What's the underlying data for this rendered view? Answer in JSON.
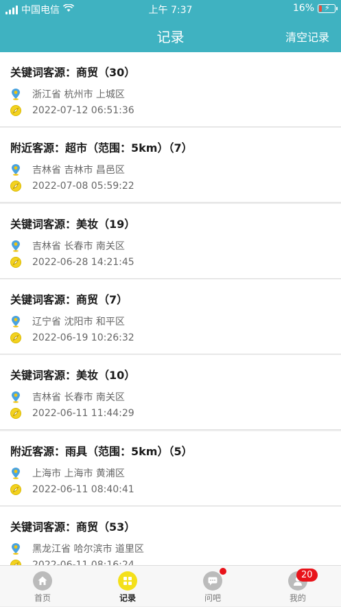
{
  "status_bar": {
    "carrier": "中国电信",
    "time": "上午 7:37",
    "battery": "16%"
  },
  "nav": {
    "title": "记录",
    "clear_label": "清空记录"
  },
  "records": [
    {
      "title": "关键词客源：商贸（30）",
      "location": "浙江省 杭州市 上城区",
      "time": "2022-07-12 06:51:36"
    },
    {
      "title": "附近客源：超市（范围：5km）（7）",
      "location": "吉林省 吉林市 昌邑区",
      "time": "2022-07-08 05:59:22"
    },
    {
      "title": "关键词客源：美妆（19）",
      "location": "吉林省 长春市 南关区",
      "time": "2022-06-28 14:21:45"
    },
    {
      "title": "关键词客源：商贸（7）",
      "location": "辽宁省 沈阳市 和平区",
      "time": "2022-06-19 10:26:32"
    },
    {
      "title": "关键词客源：美妆（10）",
      "location": "吉林省 长春市 南关区",
      "time": "2022-06-11 11:44:29"
    },
    {
      "title": "附近客源：雨具（范围：5km）（5）",
      "location": "上海市 上海市 黄浦区",
      "time": "2022-06-11 08:40:41"
    },
    {
      "title": "关键词客源：商贸（53）",
      "location": "黑龙江省 哈尔滨市 道里区",
      "time": "2022-06-11 08:16:24"
    }
  ],
  "tabs": [
    {
      "label": "首页",
      "icon": "home-icon"
    },
    {
      "label": "记录",
      "icon": "grid-icon"
    },
    {
      "label": "问吧",
      "icon": "chat-icon"
    },
    {
      "label": "我的",
      "icon": "user-icon",
      "badge": "20"
    }
  ],
  "colors": {
    "header": "#3fb2c1",
    "active_tab": "#f4e01b",
    "badge": "#e8131a"
  }
}
